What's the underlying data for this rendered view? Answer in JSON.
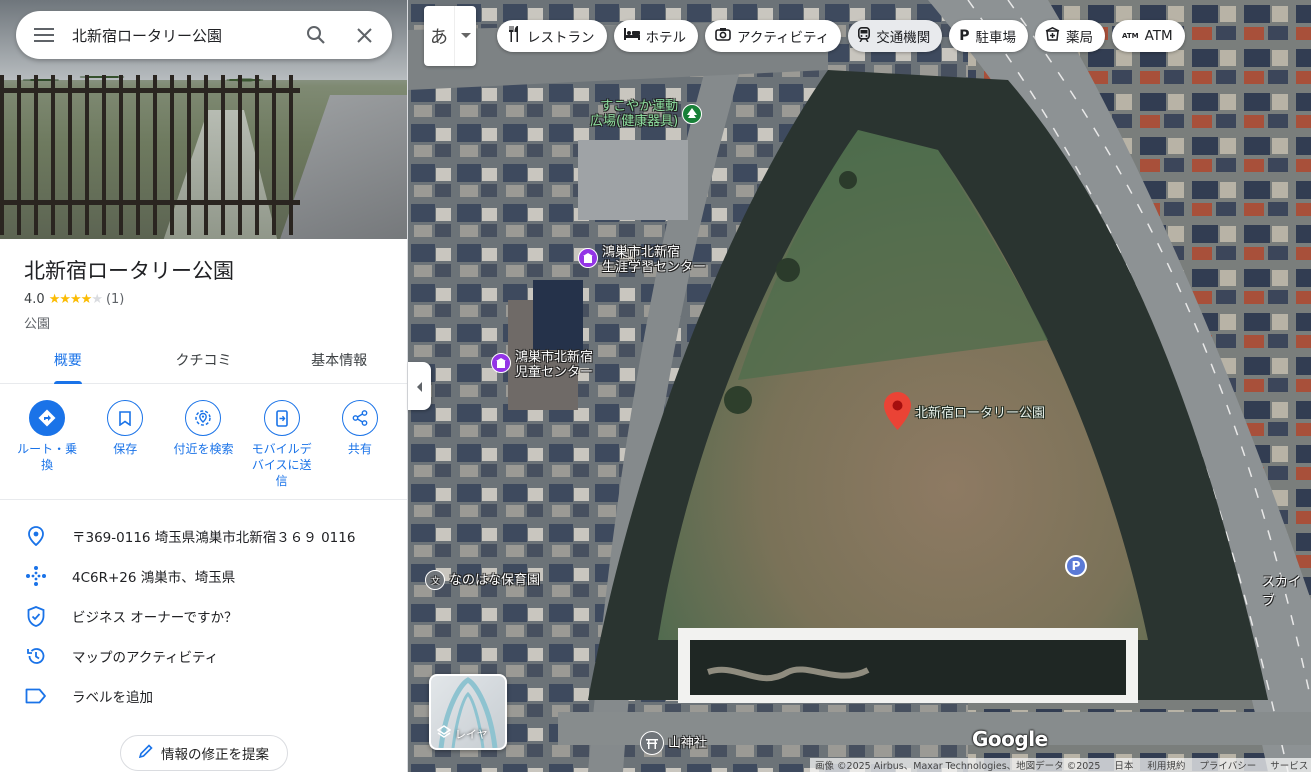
{
  "search": {
    "query": "北新宿ロータリー公園"
  },
  "place": {
    "title": "北新宿ロータリー公園",
    "rating": "4.0",
    "stars": 4,
    "review_count": "(1)",
    "category": "公園"
  },
  "tabs": [
    {
      "label": "概要",
      "active": true
    },
    {
      "label": "クチコミ",
      "active": false
    },
    {
      "label": "基本情報",
      "active": false
    }
  ],
  "actions": [
    {
      "label": "ルート・乗換",
      "icon": "directions-icon"
    },
    {
      "label": "保存",
      "icon": "bookmark-icon"
    },
    {
      "label": "付近を検索",
      "icon": "nearby-icon"
    },
    {
      "label": "モバイルデバイスに送信",
      "icon": "send-to-phone-icon"
    },
    {
      "label": "共有",
      "icon": "share-icon"
    }
  ],
  "info_rows": [
    {
      "text": "〒369-0116 埼玉県鴻巣市北新宿３６９ 0116",
      "icon": "location-pin-icon"
    },
    {
      "text": "4C6R+26 鴻巣市、埼玉県",
      "icon": "plus-code-icon"
    },
    {
      "text": "ビジネス オーナーですか？",
      "icon": "verified-shield-icon"
    },
    {
      "text": "マップのアクティビティ",
      "icon": "history-icon"
    },
    {
      "text": "ラベルを追加",
      "icon": "label-icon"
    }
  ],
  "suggest_edit": "情報の修正を提案",
  "ime": {
    "char": "あ"
  },
  "chips": [
    {
      "label": "レストラン",
      "icon": "restaurant-icon",
      "selected": false
    },
    {
      "label": "ホテル",
      "icon": "hotel-icon",
      "selected": false
    },
    {
      "label": "アクティビティ",
      "icon": "camera-icon",
      "selected": false
    },
    {
      "label": "交通機関",
      "icon": "transit-icon",
      "selected": true
    },
    {
      "label": "駐車場",
      "icon": "parking-icon",
      "selected": false
    },
    {
      "label": "薬局",
      "icon": "pharmacy-icon",
      "selected": false
    },
    {
      "label": "ATM",
      "icon": "atm-icon",
      "selected": false
    }
  ],
  "map": {
    "pois": [
      {
        "label_line1": "すこやか運動",
        "label_line2": "広場(健康器具)",
        "icon": "tree-icon"
      },
      {
        "label_line1": "鴻巣市北新宿",
        "label_line2": "生涯学習センター",
        "icon": "building-icon"
      },
      {
        "label_line1": "鴻巣市北新宿",
        "label_line2": "児童センター",
        "icon": "building-icon"
      },
      {
        "label_line1": "なのはな保育園",
        "icon": "school-icon"
      },
      {
        "label_line1": "山神社",
        "icon": "shrine-icon"
      }
    ],
    "pin_label": "北新宿ロータリー公園",
    "parking_marker": "P",
    "edge_label": "スカイブ",
    "layer_label": "レイヤ",
    "logo": "Google",
    "attribution": [
      "画像 ©2025 Airbus、Maxar Technologies、地図データ ©2025",
      "日本",
      "利用規約",
      "プライバシー",
      "サービス"
    ]
  }
}
